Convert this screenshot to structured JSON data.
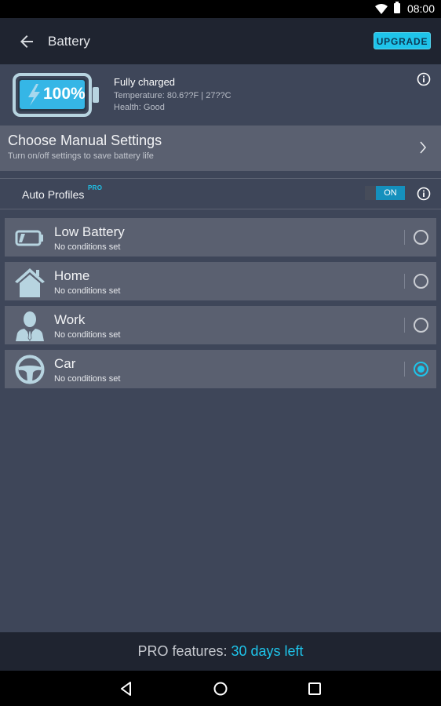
{
  "statusbar": {
    "time": "08:00",
    "icons": [
      "wifi-icon",
      "battery-icon"
    ]
  },
  "appbar": {
    "title": "Battery",
    "back_icon": "arrow-left-icon",
    "upgrade_label": "UPGRADE"
  },
  "battery": {
    "percent_label": "100%",
    "level_percent": 100,
    "status": "Fully charged",
    "temperature": "Temperature: 80.6??F | 27??C",
    "health": "Health: Good",
    "info_icon": "info-icon"
  },
  "manual_settings": {
    "title": "Choose Manual Settings",
    "subtitle": "Turn on/off settings to save battery life",
    "chevron_icon": "chevron-right-icon"
  },
  "auto_profiles": {
    "label": "Auto Profiles",
    "badge": "PRO",
    "toggle_label": "ON",
    "toggle_state": true,
    "info_icon": "info-icon"
  },
  "profiles": [
    {
      "name": "Low Battery",
      "conditions": "No conditions set",
      "icon": "low-battery-icon",
      "selected": false
    },
    {
      "name": "Home",
      "conditions": "No conditions set",
      "icon": "home-icon",
      "selected": false
    },
    {
      "name": "Work",
      "conditions": "No conditions set",
      "icon": "businessman-icon",
      "selected": false
    },
    {
      "name": "Car",
      "conditions": "No conditions set",
      "icon": "steering-wheel-icon",
      "selected": true
    }
  ],
  "footer": {
    "prefix": "PRO features: ",
    "highlight": "30 days left"
  },
  "navbar": {
    "buttons": [
      "back-nav-icon",
      "home-nav-icon",
      "recents-nav-icon"
    ]
  },
  "colors": {
    "accent": "#1ec4ea",
    "appbar": "#1f2430",
    "background": "#3e4659",
    "card": "#5a6070",
    "toggle_on": "#1590bd"
  }
}
